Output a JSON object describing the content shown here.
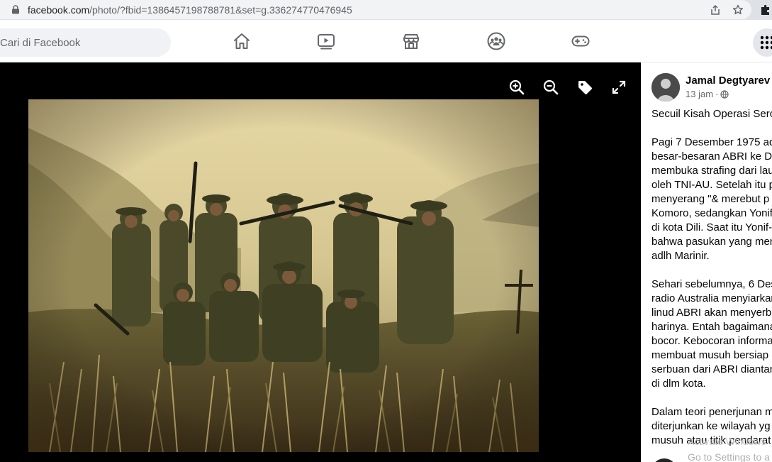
{
  "browser": {
    "url_host": "facebook.com",
    "url_path": "/photo/?fbid=1386457198788781&set=g.336274770476945",
    "icons": [
      "lock-icon",
      "share-icon",
      "star-icon",
      "extension-puzzle-icon"
    ]
  },
  "header": {
    "search_placeholder": "Cari di Facebook",
    "tabs": [
      "home-icon",
      "watch-icon",
      "marketplace-icon",
      "groups-icon",
      "gaming-icon"
    ],
    "menu_icon": "grid-menu-icon"
  },
  "viewer": {
    "tools": [
      "zoom-in-icon",
      "zoom-out-icon",
      "tag-icon",
      "fullscreen-icon"
    ]
  },
  "post": {
    "author": "Jamal Degtyarev",
    "time": "13 jam",
    "separator": "·",
    "lines": [
      "Secuil Kisah Operasi Seroj",
      "",
      "Pagi 7 Desember 1975 ada",
      "besar-besaran ABRI ke Dil",
      "membuka strafing dari lau",
      "oleh TNI-AU. Setelah itu p",
      "menyerang \"& merebut p",
      "Komoro, sedangkan Yonif",
      "di kota Dili. Saat itu Yonif-",
      "bahwa pasukan yang men",
      "adlh Marinir.",
      "",
      "Sehari sebelumnya, 6 Des",
      "radio Australia menyiarkar",
      "linud ABRI akan menyerbu",
      "harinya. Entah bagaimana",
      "bocor. Kebocoran informa",
      "membuat musuh bersiap",
      "serbuan dari ABRI diantar",
      "di dlm kota.",
      "",
      "Dalam teori penerjunan m",
      "diterjunkan ke wilayah yg",
      "musuh atau titik pendarat"
    ],
    "watermark_1": "Activate Windows",
    "watermark_2": "Go to Settings to a"
  }
}
